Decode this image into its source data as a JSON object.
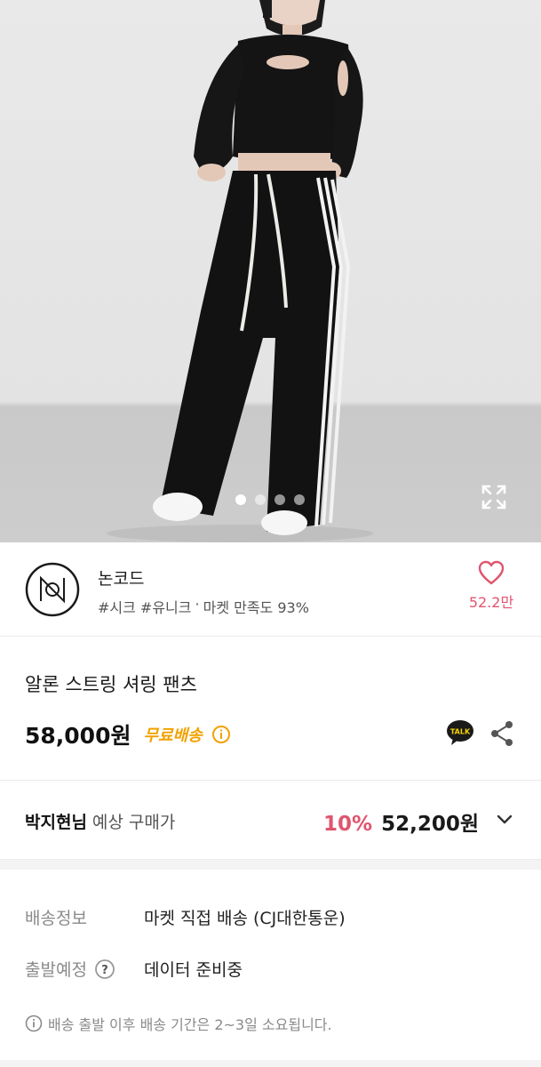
{
  "hero": {
    "image_alt": "product-photo",
    "slide_count": 4,
    "active_slide": 1,
    "expand_icon": "expand-icon"
  },
  "shop": {
    "logo_icon": "shop-logo-icon",
    "name": "논코드",
    "tags": "#시크 #유니크",
    "separator": "·",
    "satisfaction": "마켓 만족도 93%",
    "like_icon": "heart-icon",
    "like_count": "52.2만"
  },
  "product": {
    "name": "알론 스트링 셔링 팬츠",
    "price": "58,000원",
    "free_shipping": "무료배송",
    "info_icon": "info-icon",
    "talk_icon": "kakao-talk-icon",
    "talk_text": "TALK",
    "share_icon": "share-icon"
  },
  "member": {
    "name": "박지현님",
    "label": "예상 구매가",
    "discount": "10%",
    "price": "52,200원",
    "chevron_icon": "chevron-down-icon"
  },
  "shipping": {
    "info_label": "배송정보",
    "info_value": "마켓 직접 배송 (CJ대한통운)",
    "departure_label": "출발예정",
    "departure_help_icon": "question-icon",
    "departure_value": "데이터 준비중",
    "note_icon": "info-icon",
    "note": "배송 출발 이후 배송 기간은 2~3일 소요됩니다."
  },
  "colors": {
    "accent_pink": "#e0556f",
    "free_shipping": "#f2a100",
    "muted_text": "#8a8a8a"
  }
}
